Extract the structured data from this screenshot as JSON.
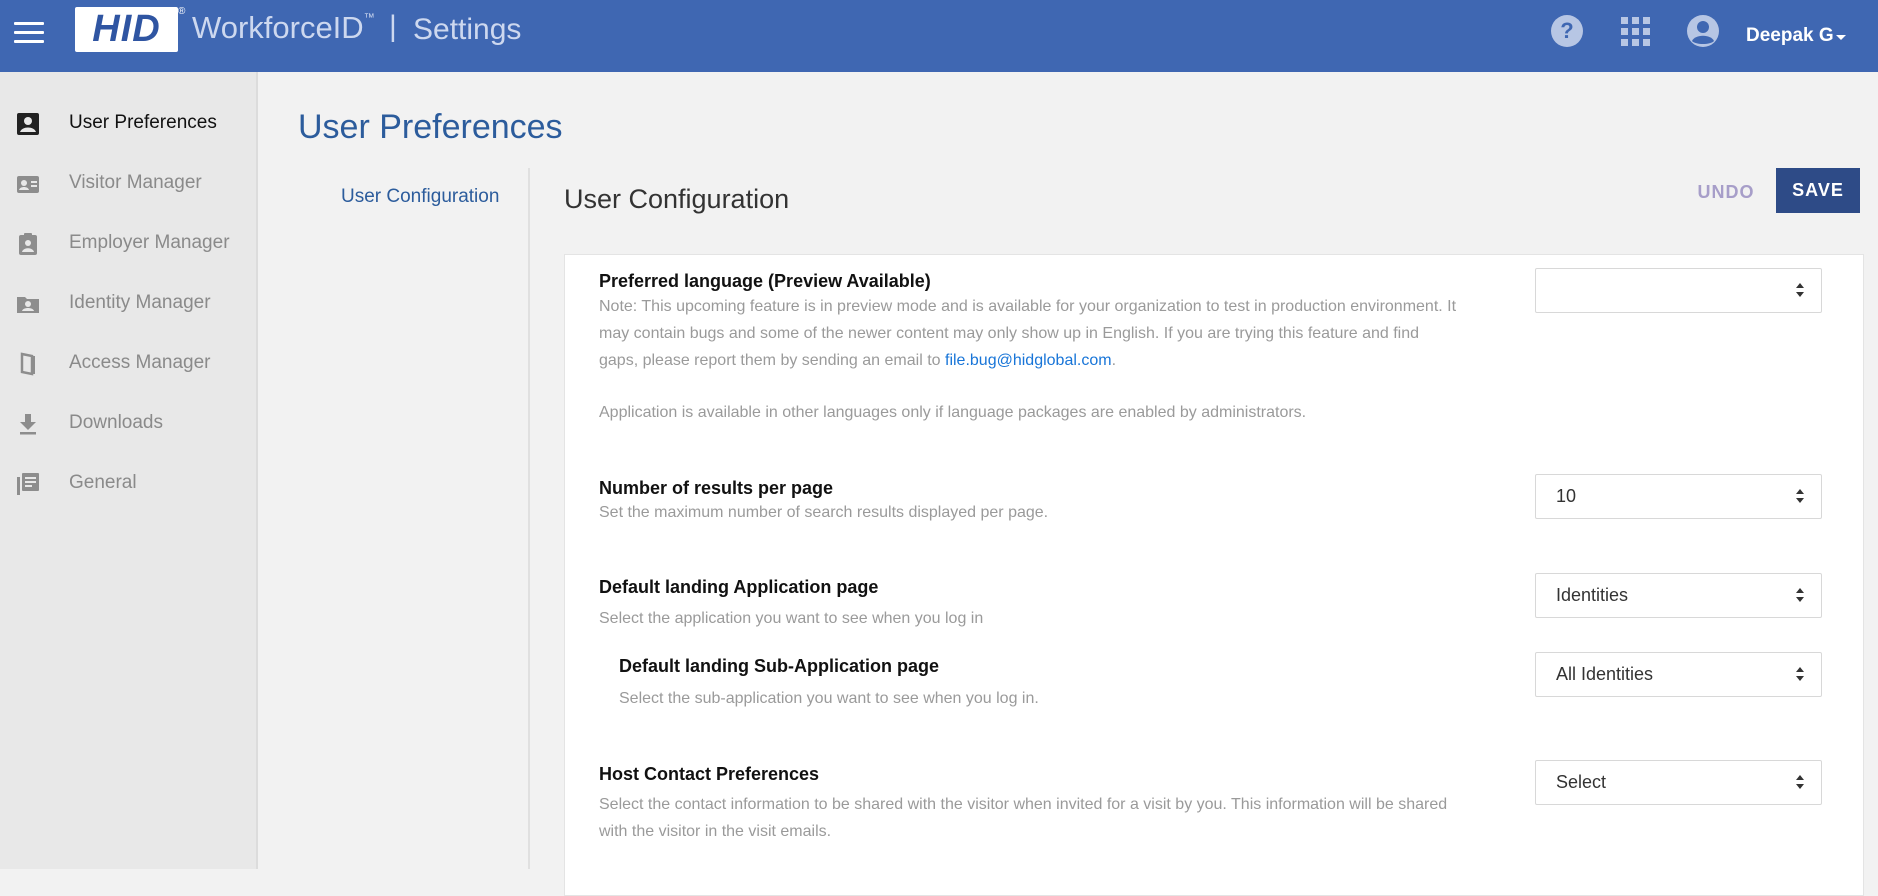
{
  "header": {
    "logo_text": "HID",
    "logo_reg": "®",
    "brand": "WorkforceID",
    "brand_tm": "™",
    "separator": "|",
    "section": "Settings",
    "user_name": "Deepak G"
  },
  "sidebar": {
    "items": [
      {
        "label": "User Preferences",
        "icon": "user-preferences-icon",
        "active": true
      },
      {
        "label": "Visitor Manager",
        "icon": "visitor-badge-icon"
      },
      {
        "label": "Employer Manager",
        "icon": "clipboard-user-icon"
      },
      {
        "label": "Identity Manager",
        "icon": "folder-user-icon"
      },
      {
        "label": "Access Manager",
        "icon": "door-icon"
      },
      {
        "label": "Downloads",
        "icon": "download-icon"
      },
      {
        "label": "General",
        "icon": "library-icon"
      }
    ]
  },
  "page": {
    "title": "User Preferences",
    "subnav": "User Configuration",
    "section_title": "User Configuration",
    "undo_label": "UNDO",
    "save_label": "SAVE"
  },
  "settings": {
    "language": {
      "label": "Preferred language (Preview Available)",
      "note_1": "Note: This upcoming feature is in preview mode and is available for your organization to test in production environment. It",
      "note_2": "may contain bugs and some of the newer content may only show up in English. If you are trying this feature and find",
      "note_3": "gaps, please report them by sending an email to",
      "email": "file.bug@hidglobal.com",
      "note_end": ".",
      "note_4": "Application is available in other languages only if language packages are enabled by administrators.",
      "value": ""
    },
    "results": {
      "label": "Number of results per page",
      "desc": "Set the maximum number of search results displayed per page.",
      "value": "10"
    },
    "landing": {
      "label": "Default landing Application page",
      "desc": "Select the application you want to see when you log in",
      "value": "Identities"
    },
    "sub_landing": {
      "label": "Default landing Sub-Application page",
      "desc": "Select the sub-application you want to see when you log in.",
      "value": "All Identities"
    },
    "host_contact": {
      "label": "Host Contact Preferences",
      "desc_1": "Select the contact information to be shared with the visitor when invited for a visit by you. This information will be shared",
      "desc_2": "with the visitor in the visit emails.",
      "value": "Select"
    }
  }
}
